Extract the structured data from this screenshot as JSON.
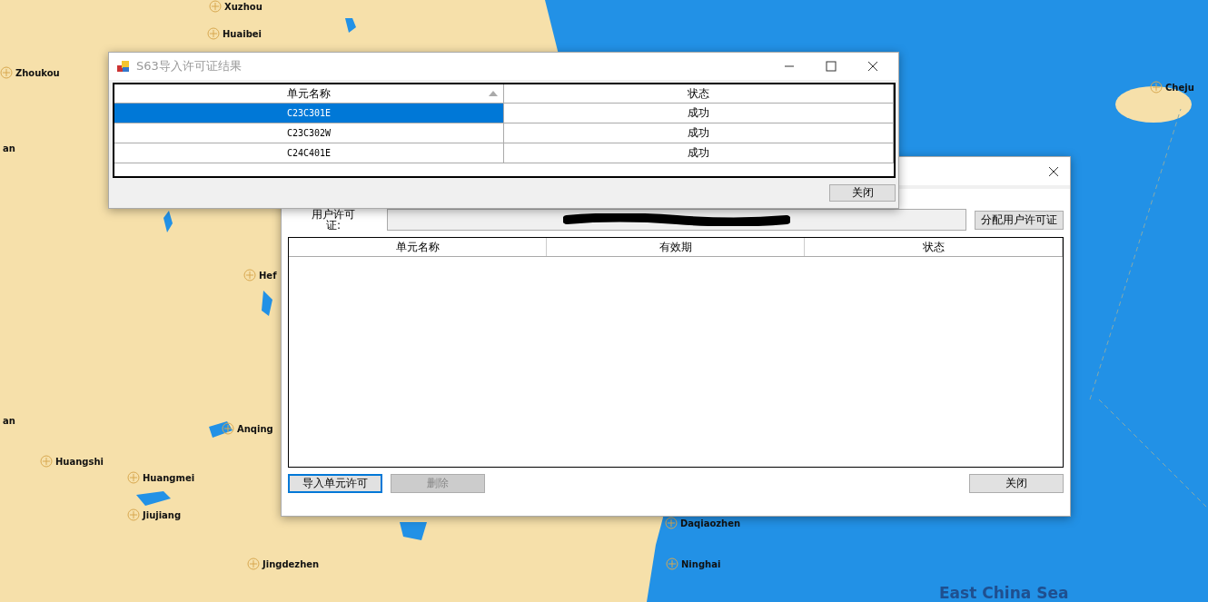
{
  "map": {
    "labels": [
      {
        "text": "Xuzhou",
        "kind": "city"
      },
      {
        "text": "Huaibei",
        "kind": "city"
      },
      {
        "text": "Zhoukou",
        "kind": "city"
      },
      {
        "text": "an",
        "kind": "city"
      },
      {
        "text": "Hef",
        "kind": "city"
      },
      {
        "text": "an",
        "kind": "city"
      },
      {
        "text": "Anqing",
        "kind": "city"
      },
      {
        "text": "Huangshi",
        "kind": "city"
      },
      {
        "text": "Huangmei",
        "kind": "city"
      },
      {
        "text": "Jiujiang",
        "kind": "city"
      },
      {
        "text": "Jingdezhen",
        "kind": "city"
      },
      {
        "text": "Daqiaozhen",
        "kind": "city"
      },
      {
        "text": "Ninghai",
        "kind": "city"
      },
      {
        "text": "Cheju",
        "kind": "city"
      },
      {
        "text": "East China Sea",
        "kind": "sea"
      }
    ]
  },
  "result_window": {
    "title": "S63导入许可证结果",
    "columns": [
      {
        "label": "单元名称",
        "sorted": true
      },
      {
        "label": "状态",
        "sorted": false
      }
    ],
    "rows": [
      {
        "cells": [
          "C23C301E",
          "成功"
        ],
        "selected": true
      },
      {
        "cells": [
          "C23C302W",
          "成功"
        ],
        "selected": false
      },
      {
        "cells": [
          "C24C401E",
          "成功"
        ],
        "selected": false
      }
    ],
    "close_button": "关闭"
  },
  "license_window": {
    "field_label": "用户许可证:",
    "assign_button": "分配用户许可证",
    "columns": [
      "单元名称",
      "有效期",
      "状态"
    ],
    "buttons": [
      {
        "label": "导入单元许可",
        "disabled": false,
        "focused": true
      },
      {
        "label": "删除",
        "disabled": true,
        "focused": false
      }
    ],
    "close_button": "关闭"
  }
}
